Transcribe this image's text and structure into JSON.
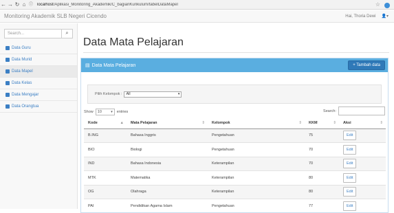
{
  "browser": {
    "url_prefix": "localhost",
    "url_path": "/Aplikasi_Monitoring_Akademik/C_bagianKurikulum/tabelDataMapel",
    "bookmark_icon": "star-icon"
  },
  "topbar": {
    "brand": "Monitoring Akademik SLB Negeri Cicendo",
    "user_greeting": "Hai, Thoria Dewi",
    "user_icon": "user-icon"
  },
  "sidebar": {
    "search_placeholder": "Search...",
    "items": [
      {
        "label": "Data Guru",
        "icon": "users-icon"
      },
      {
        "label": "Data Murid",
        "icon": "users-icon"
      },
      {
        "label": "Data Mapel",
        "icon": "book-icon"
      },
      {
        "label": "Data Kelas",
        "icon": "table-icon"
      },
      {
        "label": "Data Mengajar",
        "icon": "table-icon"
      },
      {
        "label": "Data Orangtua",
        "icon": "user-icon"
      }
    ]
  },
  "page": {
    "title": "Data Mata Pelajaran"
  },
  "panel": {
    "title": "Data Mata Pelajaran",
    "add_button": "+ Tambah data",
    "filter_label": "Pilih Kelompok :",
    "filter_value": "All",
    "show_label": "Show",
    "show_value": "10",
    "entries_label": "entries",
    "search_label": "Search:"
  },
  "table": {
    "columns": [
      "Kode",
      "Mata Pelajaran",
      "Kelompok",
      "KKM",
      "Aksi"
    ],
    "edit_label": "Edit",
    "rows": [
      {
        "kode": "B.ING",
        "mapel": "Bahasa Inggris",
        "kelompok": "Pengetahuan",
        "kkm": "75"
      },
      {
        "kode": "BIO",
        "mapel": "Biologi",
        "kelompok": "Pengetahuan",
        "kkm": "70"
      },
      {
        "kode": "IND",
        "mapel": "Bahasa Indonesia",
        "kelompok": "Keterampilan",
        "kkm": "70"
      },
      {
        "kode": "MTK",
        "mapel": "Matematika",
        "kelompok": "Keterampilan",
        "kkm": "80"
      },
      {
        "kode": "OG",
        "mapel": "Olahraga",
        "kelompok": "Keterampilan",
        "kkm": "80"
      },
      {
        "kode": "PAI",
        "mapel": "Pendidikan Agama Islam",
        "kelompok": "Pengetahuan",
        "kkm": "77"
      }
    ]
  }
}
